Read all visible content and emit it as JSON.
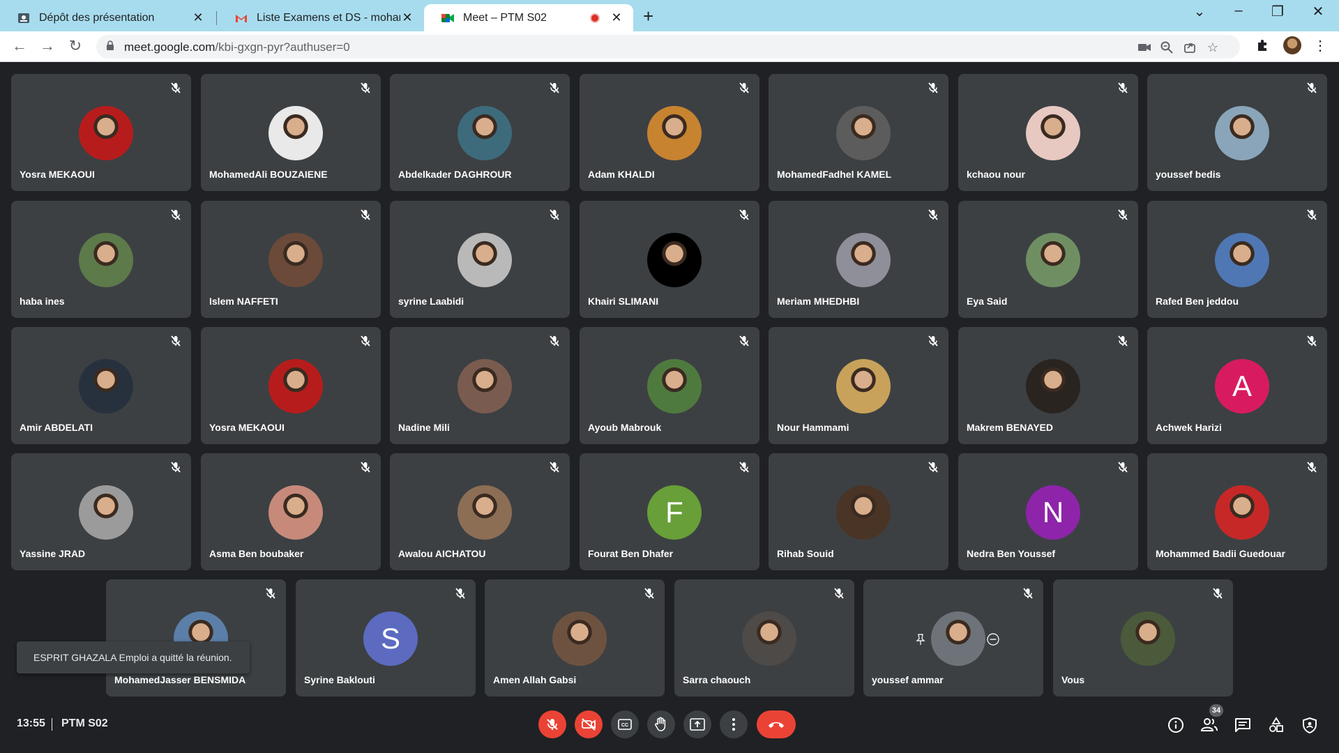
{
  "browser": {
    "tabs": [
      {
        "title": "Dépôt des présentation",
        "favicon": "document-icon"
      },
      {
        "title": "Liste Examens et DS - mohamed.",
        "favicon": "gmail-icon"
      },
      {
        "title": "Meet – PTM S02",
        "favicon": "meet-icon",
        "recording": true
      }
    ],
    "url_host": "meet.google.com",
    "url_rest": "/kbi-gxgn-pyr?authuser=0"
  },
  "participants": [
    {
      "name": "Yosra MEKAOUI",
      "avatar": {
        "type": "photo",
        "color": "#b71c1c"
      }
    },
    {
      "name": "MohamedAli BOUZAIENE",
      "avatar": {
        "type": "photo",
        "color": "#e9e9e9"
      }
    },
    {
      "name": "Abdelkader DAGHROUR",
      "avatar": {
        "type": "photo",
        "color": "#3d6b7c"
      }
    },
    {
      "name": "Adam KHALDI",
      "avatar": {
        "type": "photo",
        "color": "#c7832f"
      }
    },
    {
      "name": "MohamedFadhel KAMEL",
      "avatar": {
        "type": "photo",
        "color": "#5c5c5c"
      }
    },
    {
      "name": "kchaou nour",
      "avatar": {
        "type": "photo",
        "color": "#e7c9c2"
      }
    },
    {
      "name": "youssef bedis",
      "avatar": {
        "type": "photo",
        "color": "#8aa5b9"
      }
    },
    {
      "name": "haba ines",
      "avatar": {
        "type": "photo",
        "color": "#5d7a4a"
      }
    },
    {
      "name": "Islem NAFFETI",
      "avatar": {
        "type": "photo",
        "color": "#6b4a3a"
      }
    },
    {
      "name": "syrine Laabidi",
      "avatar": {
        "type": "photo",
        "color": "#b9b9b9"
      }
    },
    {
      "name": "Khairi SLIMANI",
      "avatar": {
        "type": "photo",
        "color": "#000000"
      }
    },
    {
      "name": "Meriam MHEDHBI",
      "avatar": {
        "type": "photo",
        "color": "#8f8f9a"
      }
    },
    {
      "name": "Eya Said",
      "avatar": {
        "type": "photo",
        "color": "#6f8f63"
      }
    },
    {
      "name": "Rafed Ben jeddou",
      "avatar": {
        "type": "photo",
        "color": "#4f77b4"
      }
    },
    {
      "name": "Amir ABDELATI",
      "avatar": {
        "type": "photo",
        "color": "#27313e"
      }
    },
    {
      "name": "Yosra MEKAOUI",
      "avatar": {
        "type": "photo",
        "color": "#b71c1c"
      }
    },
    {
      "name": "Nadine Mili",
      "avatar": {
        "type": "photo",
        "color": "#7a5b4f"
      }
    },
    {
      "name": "Ayoub Mabrouk",
      "avatar": {
        "type": "photo",
        "color": "#4f7a3e"
      }
    },
    {
      "name": "Nour Hammami",
      "avatar": {
        "type": "photo",
        "color": "#c8a25a"
      }
    },
    {
      "name": "Makrem BENAYED",
      "avatar": {
        "type": "photo",
        "color": "#2a2420"
      }
    },
    {
      "name": "Achwek Harizi",
      "avatar": {
        "type": "letter",
        "letter": "A",
        "color": "#d81b60"
      }
    },
    {
      "name": "Yassine JRAD",
      "avatar": {
        "type": "photo",
        "color": "#9b9b9b"
      }
    },
    {
      "name": "Asma Ben boubaker",
      "avatar": {
        "type": "photo",
        "color": "#c78a7a"
      }
    },
    {
      "name": "Awalou AICHATOU",
      "avatar": {
        "type": "photo",
        "color": "#8c6e55"
      }
    },
    {
      "name": "Fourat Ben Dhafer",
      "avatar": {
        "type": "letter",
        "letter": "F",
        "color": "#689f38"
      }
    },
    {
      "name": "Rihab Souid",
      "avatar": {
        "type": "photo",
        "color": "#4a3426"
      }
    },
    {
      "name": "Nedra Ben Youssef",
      "avatar": {
        "type": "letter",
        "letter": "N",
        "color": "#8e24aa"
      }
    },
    {
      "name": "Mohammed Badii Guedouar",
      "avatar": {
        "type": "photo",
        "color": "#c62828"
      }
    },
    {
      "name": "MohamedJasser BENSMIDA",
      "avatar": {
        "type": "photo",
        "color": "#5b7fa8"
      }
    },
    {
      "name": "Syrine Baklouti",
      "avatar": {
        "type": "letter",
        "letter": "S",
        "color": "#5c6bc0"
      }
    },
    {
      "name": "Amen Allah Gabsi",
      "avatar": {
        "type": "photo",
        "color": "#6e5240"
      }
    },
    {
      "name": "Sarra chaouch",
      "avatar": {
        "type": "photo",
        "color": "#4e4a47"
      }
    },
    {
      "name": "youssef ammar",
      "avatar": {
        "type": "photo",
        "color": "#6d7378"
      },
      "hover_controls": [
        "pin-icon",
        "remove-icon"
      ]
    },
    {
      "name": "Vous",
      "avatar": {
        "type": "photo",
        "color": "#4b5a3a"
      }
    }
  ],
  "toast": "ESPRIT GHAZALA Emploi a quitté la réunion.",
  "bottom": {
    "time": "13:55",
    "meeting": "PTM S02",
    "participant_count": "34"
  },
  "colors": {
    "background": "#202124",
    "tile": "#3c4043",
    "danger": "#ea4335",
    "tabbar": "#a7dcee"
  }
}
